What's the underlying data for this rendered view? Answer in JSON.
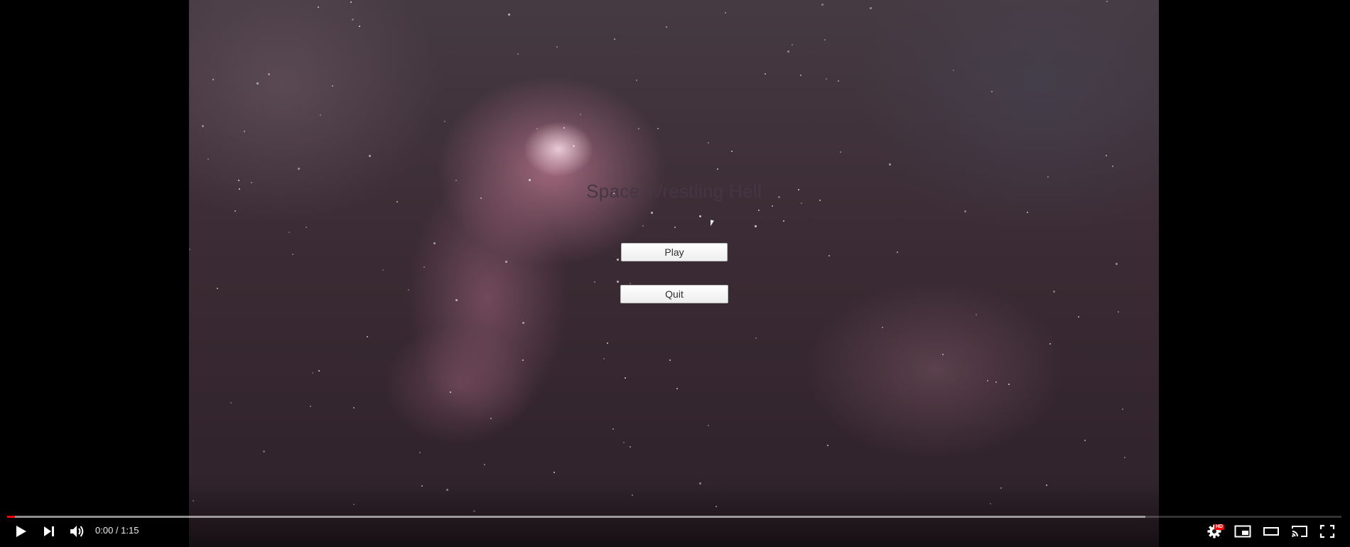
{
  "game": {
    "title": "Space Wrestling Hell",
    "play_label": "Play",
    "quit_label": "Quit"
  },
  "player": {
    "current_time": "0:00",
    "separator": " / ",
    "duration": "1:15",
    "played_fraction": 0.006,
    "loaded_fraction": 0.853,
    "quality_badge": "HD",
    "accent_color": "#ff0000"
  },
  "icons": {
    "play": "play-icon",
    "next": "next-icon",
    "volume": "volume-icon",
    "settings": "gear-icon",
    "miniplayer": "miniplayer-icon",
    "theater": "theater-mode-icon",
    "cast": "cast-icon",
    "fullscreen": "fullscreen-icon"
  }
}
